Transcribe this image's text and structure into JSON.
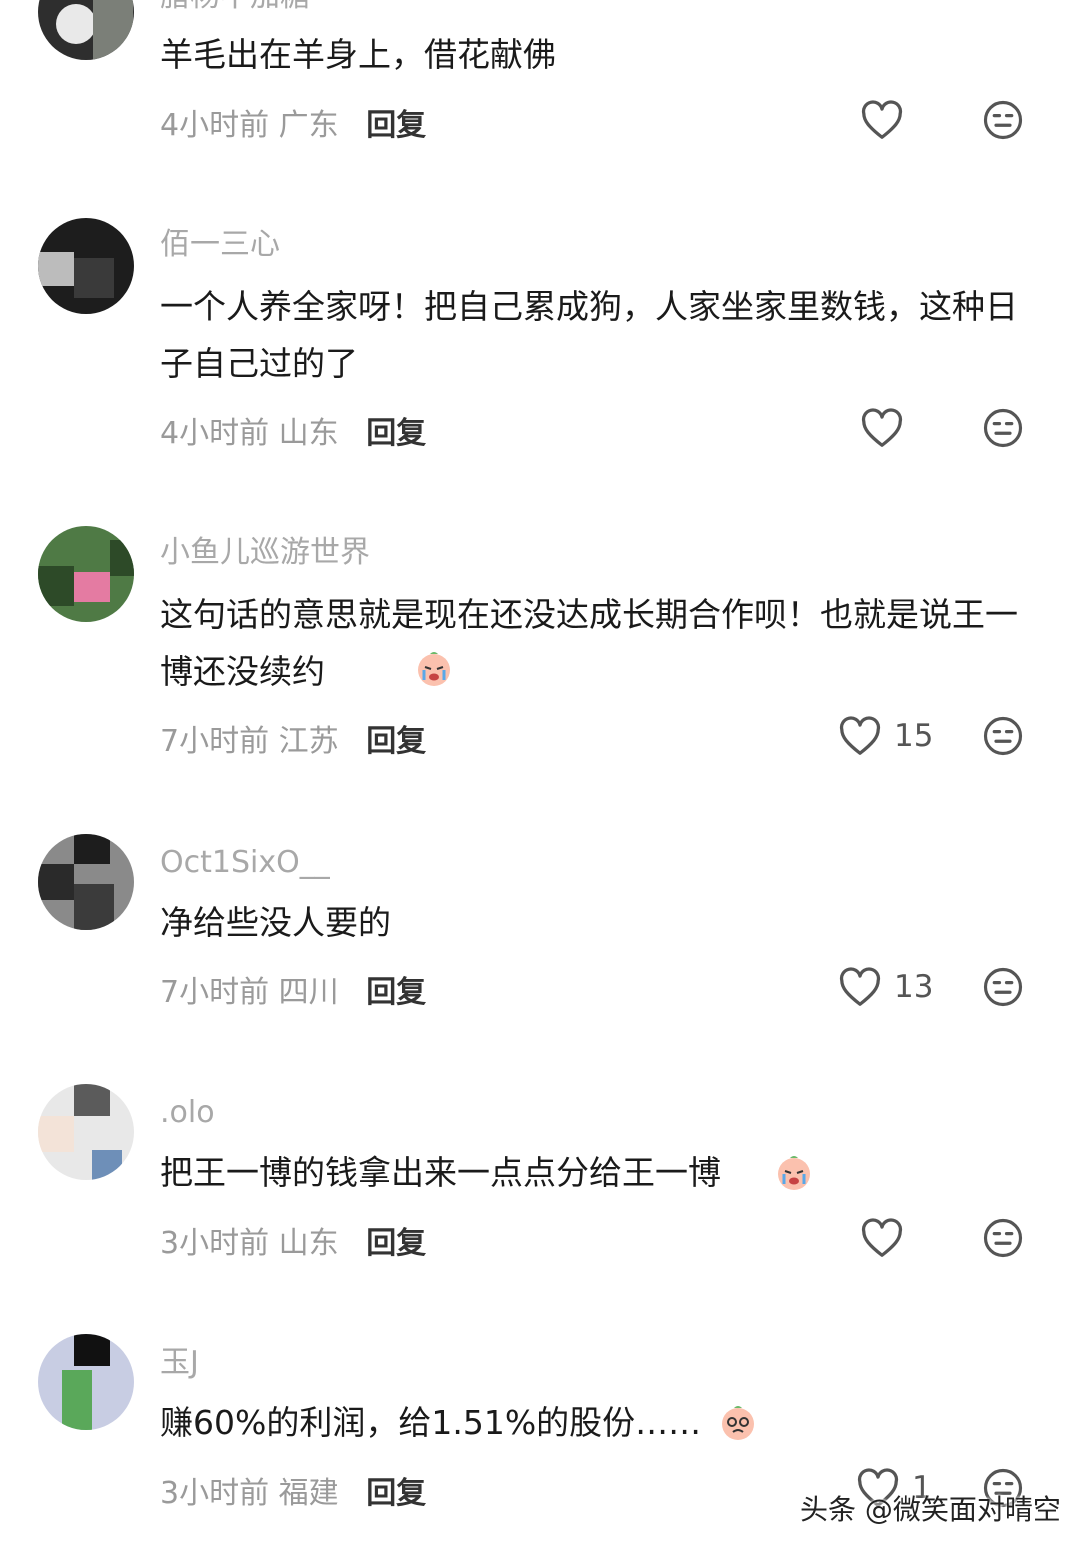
{
  "comments": [
    {
      "username": "腊杨不加糖",
      "text": "羊毛出在羊身上，借花献佛",
      "time": "4小时前",
      "location": "广东",
      "reply": "回复",
      "likes": ""
    },
    {
      "username": "佰一三心",
      "text": "一个人养全家呀！把自己累成狗，人家坐家里数钱，这种日子自己过的了",
      "time": "4小时前",
      "location": "山东",
      "reply": "回复",
      "likes": ""
    },
    {
      "username": "小鱼儿巡游世界",
      "text": "这句话的意思就是现在还没达成长期合作呗！也就是说王一博还没续约",
      "time": "7小时前",
      "location": "江苏",
      "reply": "回复",
      "likes": "15"
    },
    {
      "username": "Oct1SixO__",
      "text": "净给些没人要的",
      "time": "7小时前",
      "location": "四川",
      "reply": "回复",
      "likes": "13"
    },
    {
      "username": ".olo",
      "text": "把王一博的钱拿出来一点点分给王一博",
      "time": "3小时前",
      "location": "山东",
      "reply": "回复",
      "likes": ""
    },
    {
      "username": "玉J",
      "text": "赚60%的利润，给1.51%的股份……",
      "time": "3小时前",
      "location": "福建",
      "reply": "回复",
      "likes": "1"
    }
  ],
  "icons": {
    "like": "heart-outline-icon",
    "dislike": "neutral-face-icon",
    "emoji": "crying-peach-emoji"
  },
  "watermark": "头条 @微笑面对晴空"
}
